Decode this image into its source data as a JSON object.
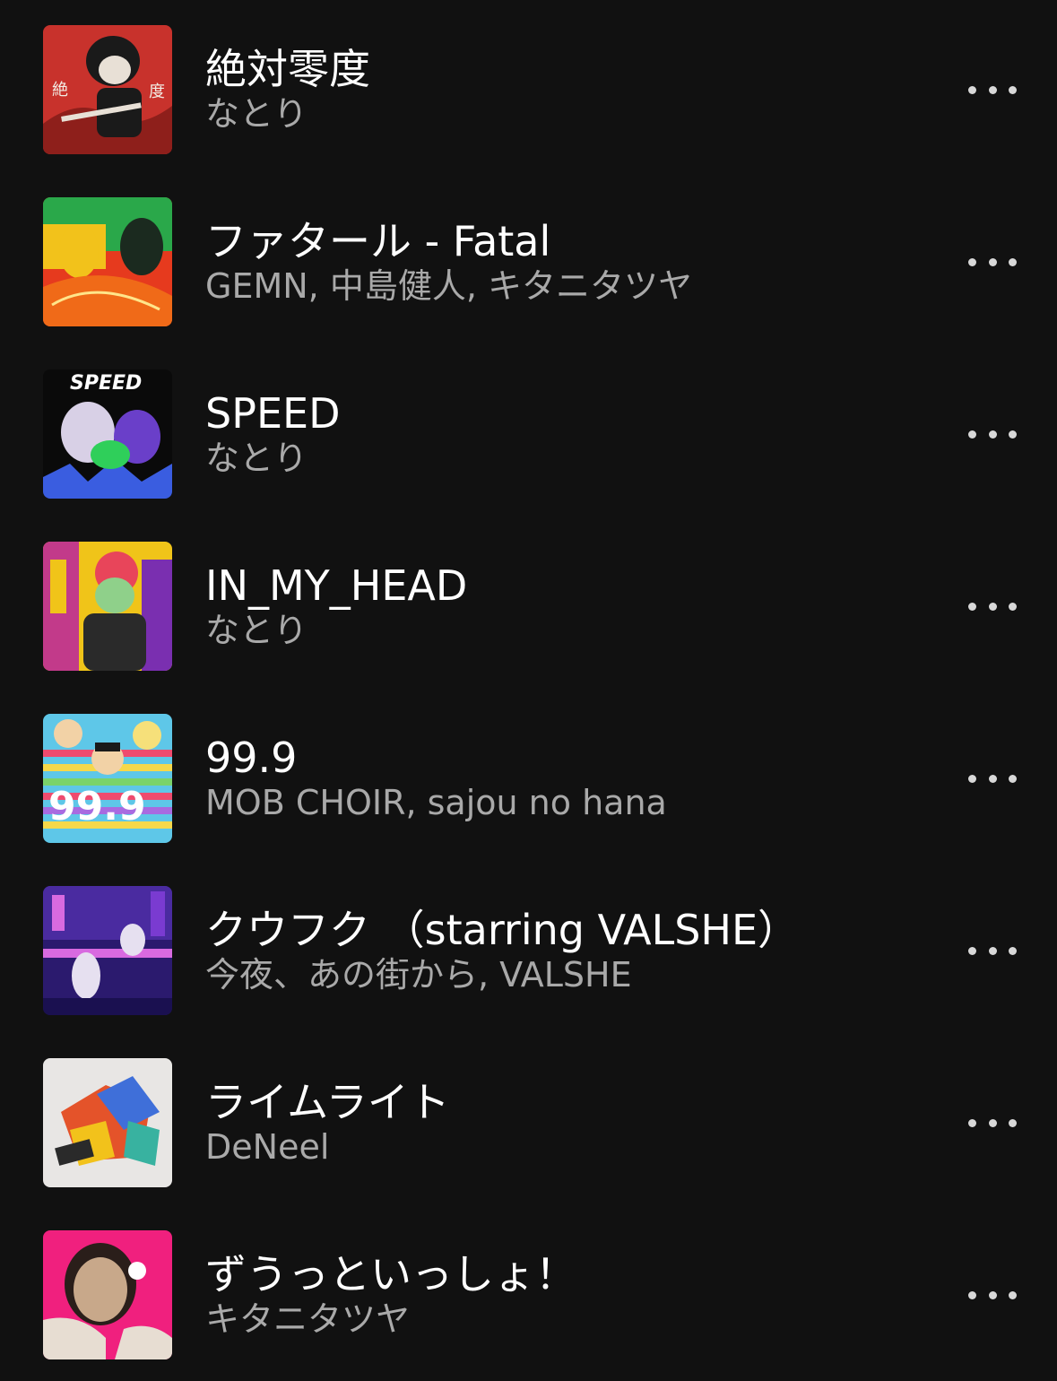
{
  "songs": [
    {
      "title": "絶対零度",
      "artist": "なとり",
      "art_colors": [
        "#c8322c",
        "#1a1a1a",
        "#e8e0d6"
      ]
    },
    {
      "title": "ファタール - Fatal",
      "artist": "GEMN, 中島健人, キタニタツヤ",
      "art_colors": [
        "#e63a1e",
        "#f2c21b",
        "#2aa84a"
      ]
    },
    {
      "title": "SPEED",
      "artist": "なとり",
      "art_colors": [
        "#0a0a0a",
        "#3a5de0",
        "#2fcf5a"
      ]
    },
    {
      "title": "IN_MY_HEAD",
      "artist": "なとり",
      "art_colors": [
        "#f0c419",
        "#c23a8a",
        "#2a2a2a"
      ]
    },
    {
      "title": "99.9",
      "artist": "MOB CHOIR, sajou no hana",
      "art_colors": [
        "#5ec7e8",
        "#ef4b6e",
        "#f6d84a"
      ]
    },
    {
      "title": "クウフク （starring VALSHE）",
      "artist": "今夜、あの街から, VALSHE",
      "art_colors": [
        "#2b1a6e",
        "#7a3bd1",
        "#d86ae0"
      ]
    },
    {
      "title": "ライムライト",
      "artist": "DeNeel",
      "art_colors": [
        "#e8e6e4",
        "#e4532a",
        "#3f6fd9"
      ]
    },
    {
      "title": "ずうっといっしょ！",
      "artist": "キタニタツヤ",
      "art_colors": [
        "#f0207e",
        "#e7ddd2",
        "#2a1e1a"
      ]
    }
  ],
  "more_icon": "more-horizontal-icon"
}
